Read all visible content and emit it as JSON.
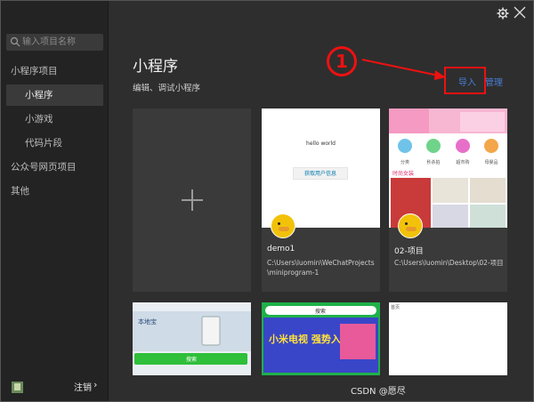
{
  "sidebar": {
    "search_placeholder": "输入项目名称",
    "items": [
      {
        "label": "小程序项目"
      },
      {
        "label": "小程序"
      },
      {
        "label": "小游戏"
      },
      {
        "label": "代码片段"
      },
      {
        "label": "公众号网页项目"
      },
      {
        "label": "其他"
      }
    ],
    "logout_label": "注销",
    "logout_chevron": "›"
  },
  "header": {
    "title": "小程序",
    "subtitle": "编辑、调试小程序",
    "import_label": "导入",
    "manage_label": "管理",
    "annotation_number": "1"
  },
  "projects": [
    {
      "name": "demo1",
      "path": "C:\\Users\\luomin\\WeChatProjects\\miniprogram-1",
      "preview_text": "hello world",
      "preview_button": "获取用户信息"
    },
    {
      "name": "02-项目",
      "path": "C:\\Users\\luomin\\Desktop\\02-项目",
      "preview_labels": [
        "分类",
        "秒杀拍",
        "超市购",
        "母婴品",
        "时尚女装"
      ]
    },
    {
      "preview_text": "本地宝",
      "preview_button": "搜索"
    },
    {
      "preview_search": "搜索",
      "preview_banner": "小米电视 强势入驻"
    },
    {
      "preview_text": "首页"
    }
  ],
  "colors": {
    "accent": "#4a7dd6",
    "annotation": "#e11111",
    "sidebar_bg": "#232323",
    "main_bg": "#2e2e2e"
  },
  "watermark": "CSDN @愿尽"
}
